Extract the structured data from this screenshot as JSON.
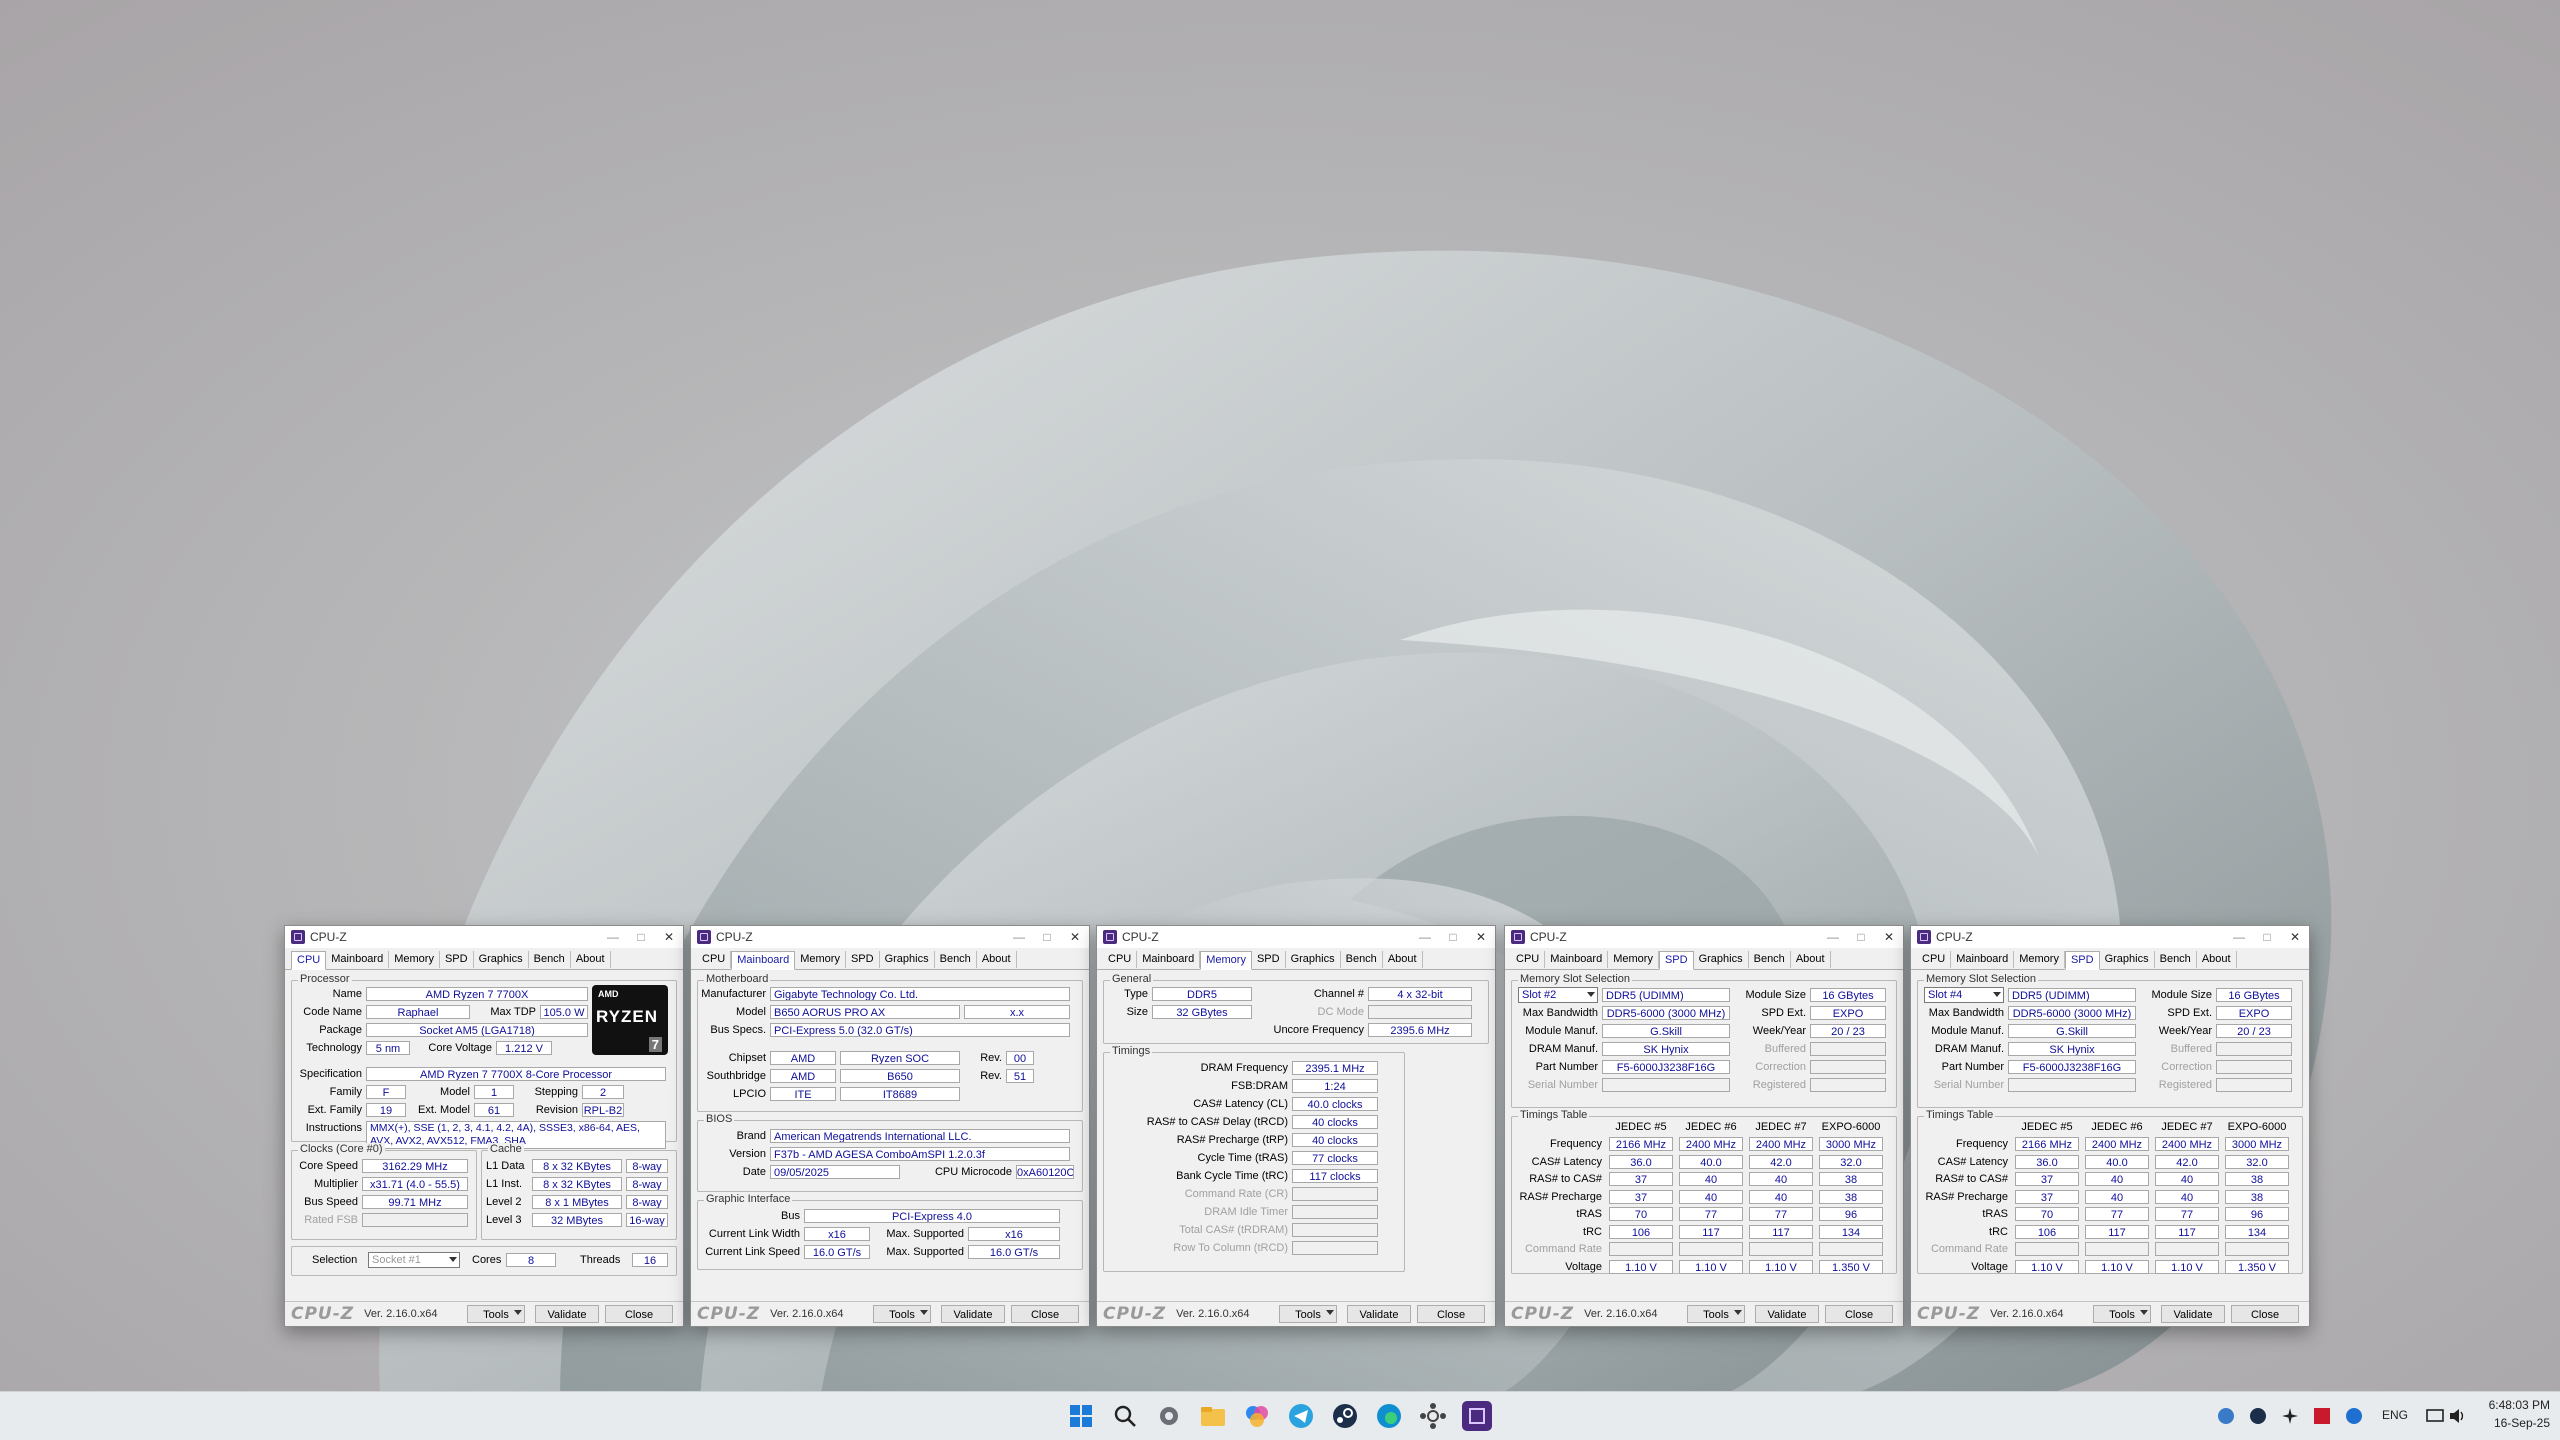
{
  "desktop": {
    "taskbar": {
      "icons": [
        "windows-start-icon",
        "search-icon",
        "settings-icon",
        "file-explorer-icon",
        "copilot-icon",
        "telegram-icon",
        "steam-icon",
        "edge-icon",
        "hwinfo-icon",
        "cpuz-icon"
      ],
      "tray": {
        "language": "ENG",
        "time": "6:48:03 PM",
        "date": "16-Sep-25"
      }
    }
  },
  "windows": [
    {
      "title": "CPU-Z",
      "tabs": [
        "CPU",
        "Mainboard",
        "Memory",
        "SPD",
        "Graphics",
        "Bench",
        "About"
      ],
      "active_tab": "CPU",
      "processor": {
        "group_title": "Processor",
        "name_label": "Name",
        "name": "AMD Ryzen 7 7700X",
        "code_name_label": "Code Name",
        "code_name": "Raphael",
        "max_tdp_label": "Max TDP",
        "max_tdp": "105.0 W",
        "package_label": "Package",
        "package": "Socket AM5 (LGA1718)",
        "technology_label": "Technology",
        "technology": "5 nm",
        "core_voltage_label": "Core Voltage",
        "core_voltage": "1.212 V",
        "specification_label": "Specification",
        "specification": "AMD Ryzen 7 7700X 8-Core Processor",
        "family_label": "Family",
        "family": "F",
        "model_label": "Model",
        "model": "1",
        "stepping_label": "Stepping",
        "stepping": "2",
        "ext_family_label": "Ext. Family",
        "ext_family": "19",
        "ext_model_label": "Ext. Model",
        "ext_model": "61",
        "revision_label": "Revision",
        "revision": "RPL-B2",
        "instructions_label": "Instructions",
        "instructions": "MMX(+), SSE (1, 2, 3, 4.1, 4.2, 4A), SSSE3, x86-64, AES, AVX, AVX2, AVX512, FMA3, SHA",
        "logo_brand": "AMD",
        "logo_text": "RYZEN",
        "logo_number": "7"
      },
      "clocks": {
        "group_title": "Clocks (Core #0)",
        "core_speed_label": "Core Speed",
        "core_speed": "3162.29 MHz",
        "multiplier_label": "Multiplier",
        "multiplier": "x31.71 (4.0 - 55.5)",
        "bus_speed_label": "Bus Speed",
        "bus_speed": "99.71 MHz",
        "rated_fsb_label": "Rated FSB",
        "rated_fsb": ""
      },
      "cache": {
        "group_title": "Cache",
        "l1d_label": "L1 Data",
        "l1d": "8 x 32 KBytes",
        "l1d_way": "8-way",
        "l1i_label": "L1 Inst.",
        "l1i": "8 x 32 KBytes",
        "l1i_way": "8-way",
        "l2_label": "Level 2",
        "l2": "8 x 1 MBytes",
        "l2_way": "8-way",
        "l3_label": "Level 3",
        "l3": "32 MBytes",
        "l3_way": "16-way"
      },
      "selection": {
        "selection_label": "Selection",
        "socket": "Socket #1",
        "cores_label": "Cores",
        "cores": "8",
        "threads_label": "Threads",
        "threads": "16"
      },
      "bottom": {
        "logo": "CPU-Z",
        "version": "Ver. 2.16.0.x64",
        "tools": "Tools",
        "validate": "Validate",
        "close": "Close"
      }
    },
    {
      "title": "CPU-Z",
      "tabs": [
        "CPU",
        "Mainboard",
        "Memory",
        "SPD",
        "Graphics",
        "Bench",
        "About"
      ],
      "active_tab": "Mainboard",
      "motherboard": {
        "group_title": "Motherboard",
        "manufacturer_label": "Manufacturer",
        "manufacturer": "Gigabyte Technology Co. Ltd.",
        "model_label": "Model",
        "model": "B650 AORUS PRO AX",
        "model_rev": "x.x",
        "bus_specs_label": "Bus Specs.",
        "bus_specs": "PCI-Express 5.0 (32.0 GT/s)",
        "chipset_label": "Chipset",
        "chipset_vendor": "AMD",
        "chipset_name": "Ryzen SOC",
        "chipset_rev_label": "Rev.",
        "chipset_rev": "00",
        "southbridge_label": "Southbridge",
        "southbridge_vendor": "AMD",
        "southbridge_name": "B650",
        "southbridge_rev_label": "Rev.",
        "southbridge_rev": "51",
        "lpcio_label": "LPCIO",
        "lpcio_vendor": "ITE",
        "lpcio_name": "IT8689"
      },
      "bios": {
        "group_title": "BIOS",
        "brand_label": "Brand",
        "brand": "American Megatrends International LLC.",
        "version_label": "Version",
        "version": "F37b - AMD AGESA ComboAmSPI 1.2.0.3f",
        "date_label": "Date",
        "date": "09/05/2025",
        "microcode_label": "CPU Microcode",
        "microcode": "0xA60120C"
      },
      "graphic_interface": {
        "group_title": "Graphic Interface",
        "bus_label": "Bus",
        "bus": "PCI-Express 4.0",
        "link_width_label": "Current Link Width",
        "link_width": "x16",
        "max_width_label": "Max. Supported",
        "max_width": "x16",
        "link_speed_label": "Current Link Speed",
        "link_speed": "16.0 GT/s",
        "max_speed_label": "Max. Supported",
        "max_speed": "16.0 GT/s"
      },
      "bottom": {
        "logo": "CPU-Z",
        "version": "Ver. 2.16.0.x64",
        "tools": "Tools",
        "validate": "Validate",
        "close": "Close"
      }
    },
    {
      "title": "CPU-Z",
      "tabs": [
        "CPU",
        "Mainboard",
        "Memory",
        "SPD",
        "Graphics",
        "Bench",
        "About"
      ],
      "active_tab": "Memory",
      "general": {
        "group_title": "General",
        "type_label": "Type",
        "type": "DDR5",
        "channel_label": "Channel #",
        "channel": "4 x 32-bit",
        "dc_mode_label": "DC Mode",
        "dc_mode": "",
        "size_label": "Size",
        "size": "32 GBytes",
        "uncore_label": "Uncore Frequency",
        "uncore": "2395.6 MHz"
      },
      "timings": {
        "group_title": "Timings",
        "rows": [
          {
            "label": "DRAM Frequency",
            "value": "2395.1 MHz",
            "dim": false
          },
          {
            "label": "FSB:DRAM",
            "value": "1:24",
            "dim": false
          },
          {
            "label": "CAS# Latency (CL)",
            "value": "40.0 clocks",
            "dim": false
          },
          {
            "label": "RAS# to CAS# Delay (tRCD)",
            "value": "40 clocks",
            "dim": false
          },
          {
            "label": "RAS# Precharge (tRP)",
            "value": "40 clocks",
            "dim": false
          },
          {
            "label": "Cycle Time (tRAS)",
            "value": "77 clocks",
            "dim": false
          },
          {
            "label": "Bank Cycle Time (tRC)",
            "value": "117 clocks",
            "dim": false
          },
          {
            "label": "Command Rate (CR)",
            "value": "",
            "dim": true
          },
          {
            "label": "DRAM Idle Timer",
            "value": "",
            "dim": true
          },
          {
            "label": "Total CAS# (tRDRAM)",
            "value": "",
            "dim": true
          },
          {
            "label": "Row To Column (tRCD)",
            "value": "",
            "dim": true
          }
        ]
      },
      "bottom": {
        "logo": "CPU-Z",
        "version": "Ver. 2.16.0.x64",
        "tools": "Tools",
        "validate": "Validate",
        "close": "Close"
      }
    },
    {
      "title": "CPU-Z",
      "tabs": [
        "CPU",
        "Mainboard",
        "Memory",
        "SPD",
        "Graphics",
        "Bench",
        "About"
      ],
      "active_tab": "SPD",
      "slot": {
        "group_title": "Memory Slot Selection",
        "slot": "Slot #2",
        "type": "DDR5 (UDIMM)",
        "module_size_label": "Module Size",
        "module_size": "16 GBytes",
        "max_bw_label": "Max Bandwidth",
        "max_bw": "DDR5-6000 (3000 MHz)",
        "spd_ext_label": "SPD Ext.",
        "spd_ext": "EXPO",
        "manuf_label": "Module Manuf.",
        "manuf": "G.Skill",
        "week_label": "Week/Year",
        "week": "20 / 23",
        "dram_manuf_label": "DRAM Manuf.",
        "dram_manuf": "SK Hynix",
        "buffered_label": "Buffered",
        "part_label": "Part Number",
        "part": "F5-6000J3238F16G",
        "correction_label": "Correction",
        "serial_label": "Serial Number",
        "registered_label": "Registered"
      },
      "timings_table": {
        "group_title": "Timings Table",
        "headers": [
          "JEDEC #5",
          "JEDEC #6",
          "JEDEC #7",
          "EXPO-6000"
        ],
        "rows": [
          {
            "label": "Frequency",
            "values": [
              "2166 MHz",
              "2400 MHz",
              "2400 MHz",
              "3000 MHz"
            ],
            "dim": false
          },
          {
            "label": "CAS# Latency",
            "values": [
              "36.0",
              "40.0",
              "42.0",
              "32.0"
            ],
            "dim": false
          },
          {
            "label": "RAS# to CAS#",
            "values": [
              "37",
              "40",
              "40",
              "38"
            ],
            "dim": false
          },
          {
            "label": "RAS# Precharge",
            "values": [
              "37",
              "40",
              "40",
              "38"
            ],
            "dim": false
          },
          {
            "label": "tRAS",
            "values": [
              "70",
              "77",
              "77",
              "96"
            ],
            "dim": false
          },
          {
            "label": "tRC",
            "values": [
              "106",
              "117",
              "117",
              "134"
            ],
            "dim": false
          },
          {
            "label": "Command Rate",
            "values": [
              "",
              "",
              "",
              ""
            ],
            "dim": true
          },
          {
            "label": "Voltage",
            "values": [
              "1.10 V",
              "1.10 V",
              "1.10 V",
              "1.350 V"
            ],
            "dim": false
          }
        ]
      },
      "bottom": {
        "logo": "CPU-Z",
        "version": "Ver. 2.16.0.x64",
        "tools": "Tools",
        "validate": "Validate",
        "close": "Close"
      }
    },
    {
      "title": "CPU-Z",
      "tabs": [
        "CPU",
        "Mainboard",
        "Memory",
        "SPD",
        "Graphics",
        "Bench",
        "About"
      ],
      "active_tab": "SPD",
      "slot": {
        "group_title": "Memory Slot Selection",
        "slot": "Slot #4",
        "type": "DDR5 (UDIMM)",
        "module_size_label": "Module Size",
        "module_size": "16 GBytes",
        "max_bw_label": "Max Bandwidth",
        "max_bw": "DDR5-6000 (3000 MHz)",
        "spd_ext_label": "SPD Ext.",
        "spd_ext": "EXPO",
        "manuf_label": "Module Manuf.",
        "manuf": "G.Skill",
        "week_label": "Week/Year",
        "week": "20 / 23",
        "dram_manuf_label": "DRAM Manuf.",
        "dram_manuf": "SK Hynix",
        "buffered_label": "Buffered",
        "part_label": "Part Number",
        "part": "F5-6000J3238F16G",
        "correction_label": "Correction",
        "serial_label": "Serial Number",
        "registered_label": "Registered"
      },
      "timings_table": {
        "group_title": "Timings Table",
        "headers": [
          "JEDEC #5",
          "JEDEC #6",
          "JEDEC #7",
          "EXPO-6000"
        ],
        "rows": [
          {
            "label": "Frequency",
            "values": [
              "2166 MHz",
              "2400 MHz",
              "2400 MHz",
              "3000 MHz"
            ],
            "dim": false
          },
          {
            "label": "CAS# Latency",
            "values": [
              "36.0",
              "40.0",
              "42.0",
              "32.0"
            ],
            "dim": false
          },
          {
            "label": "RAS# to CAS#",
            "values": [
              "37",
              "40",
              "40",
              "38"
            ],
            "dim": false
          },
          {
            "label": "RAS# Precharge",
            "values": [
              "37",
              "40",
              "40",
              "38"
            ],
            "dim": false
          },
          {
            "label": "tRAS",
            "values": [
              "70",
              "77",
              "77",
              "96"
            ],
            "dim": false
          },
          {
            "label": "tRC",
            "values": [
              "106",
              "117",
              "117",
              "134"
            ],
            "dim": false
          },
          {
            "label": "Command Rate",
            "values": [
              "",
              "",
              "",
              ""
            ],
            "dim": true
          },
          {
            "label": "Voltage",
            "values": [
              "1.10 V",
              "1.10 V",
              "1.10 V",
              "1.350 V"
            ],
            "dim": false
          }
        ]
      },
      "bottom": {
        "logo": "CPU-Z",
        "version": "Ver. 2.16.0.x64",
        "tools": "Tools",
        "validate": "Validate",
        "close": "Close"
      }
    }
  ]
}
